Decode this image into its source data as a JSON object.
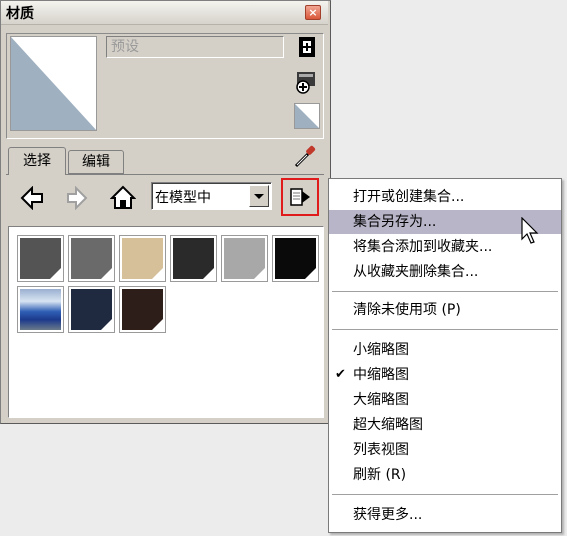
{
  "window": {
    "title": "材质",
    "close_glyph": "×"
  },
  "material": {
    "name_placeholder": "预设"
  },
  "tabs": [
    {
      "label": "选择"
    },
    {
      "label": "编辑"
    }
  ],
  "collection": {
    "selected": "在模型中"
  },
  "swatches": [
    {
      "color": "#545454"
    },
    {
      "color": "#6a6a6a"
    },
    {
      "color": "#d6c09a"
    },
    {
      "color": "#2a2a2a"
    },
    {
      "color": "#a8a8a8"
    },
    {
      "color": "#0a0a0a"
    },
    {
      "color": "photo"
    },
    {
      "color": "#1f2a40"
    },
    {
      "color": "#2d1e1a"
    }
  ],
  "menu": {
    "items": [
      {
        "label": "打开或创建集合..."
      },
      {
        "label": "集合另存为..."
      },
      {
        "label": "将集合添加到收藏夹..."
      },
      {
        "label": "从收藏夹删除集合..."
      },
      {
        "label": "清除未使用项 (P)"
      },
      {
        "label": "小缩略图"
      },
      {
        "label": "中缩略图",
        "checked": true
      },
      {
        "label": "大缩略图"
      },
      {
        "label": "超大缩略图"
      },
      {
        "label": "列表视图"
      },
      {
        "label": "刷新 (R)"
      },
      {
        "label": "获得更多..."
      }
    ],
    "highlighted_index": 1
  },
  "colors": {
    "highlight": "#b7b5c7",
    "details_border": "#e01b1b"
  }
}
